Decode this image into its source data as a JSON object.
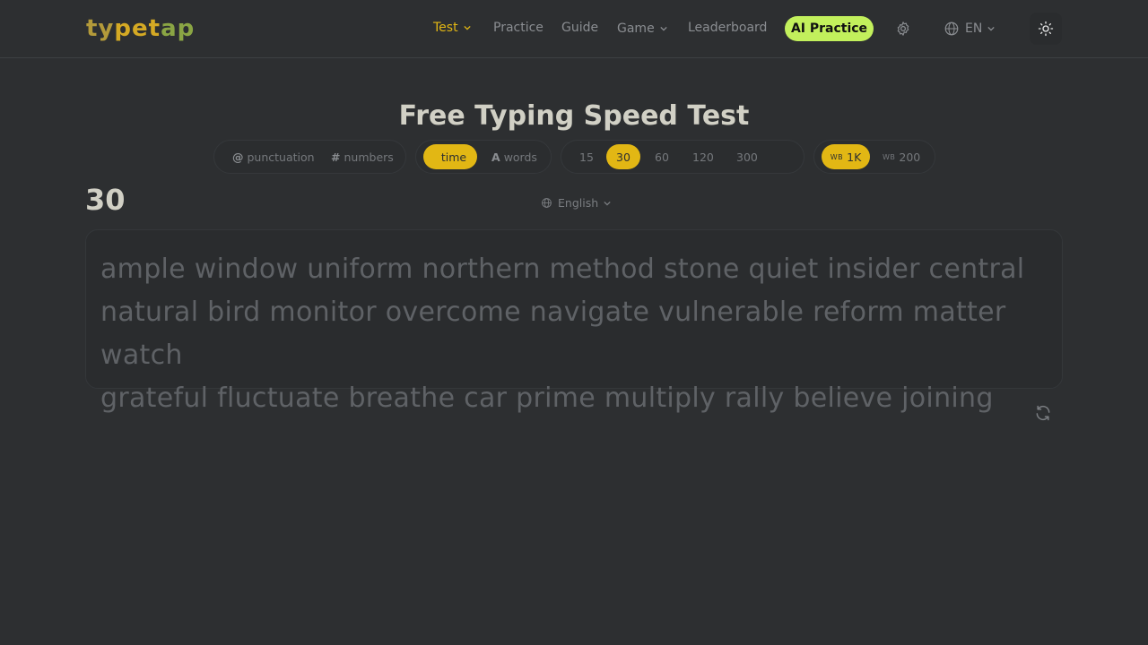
{
  "header": {
    "logo": {
      "part1": "ty",
      "part2": "pet",
      "part3": "ap"
    },
    "nav": [
      {
        "label": "Test",
        "active": true,
        "dropdown": true
      },
      {
        "label": "Practice",
        "active": false,
        "dropdown": false
      },
      {
        "label": "Guide",
        "active": false,
        "dropdown": false
      },
      {
        "label": "Game",
        "active": false,
        "dropdown": true
      },
      {
        "label": "Leaderboard",
        "active": false,
        "dropdown": false
      }
    ],
    "ai_button": "AI Practice",
    "settings_icon": "gear-icon",
    "language": "EN",
    "theme_icon": "sun-icon"
  },
  "title": "Free Typing Speed Test",
  "options": {
    "extras": [
      {
        "symbol": "@",
        "label": "punctuation"
      },
      {
        "symbol": "#",
        "label": "numbers"
      }
    ],
    "mode": [
      {
        "label": "time",
        "selected": true
      },
      {
        "symbol": "A",
        "label": "words",
        "selected": false
      }
    ],
    "durations": [
      {
        "label": "15",
        "selected": false
      },
      {
        "label": "30",
        "selected": true
      },
      {
        "label": "60",
        "selected": false
      },
      {
        "label": "120",
        "selected": false
      },
      {
        "label": "300",
        "selected": false
      }
    ],
    "wordbank": [
      {
        "prefix": "WB",
        "label": "1K",
        "selected": true
      },
      {
        "prefix": "WB",
        "label": "200",
        "selected": false
      }
    ]
  },
  "timer": "30",
  "test_language": "English",
  "words": [
    "ample window uniform northern method stone quiet insider central",
    "natural bird monitor overcome navigate vulnerable reform matter watch",
    "grateful fluctuate breathe car prime multiply rally believe joining"
  ],
  "colors": {
    "background": "#2d2f31",
    "accent": "#e2b714",
    "ai_button": "#c2f05c",
    "title": "#d1d0c5",
    "untyped_text": "#5f6266"
  }
}
